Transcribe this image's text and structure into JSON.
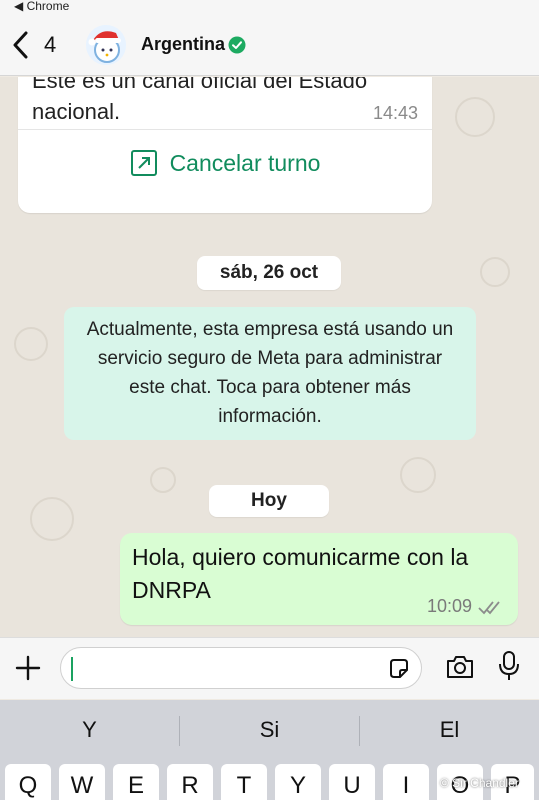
{
  "status_bar": {
    "back_app": "◀ Chrome"
  },
  "header": {
    "back_count": "4",
    "title": "Argentina",
    "verified": true
  },
  "messages": {
    "top_incoming": {
      "text": "Este es un canal oficial del Estado nacional.",
      "time": "14:43",
      "action_label": "Cancelar turno"
    },
    "date_chip_1": "sáb, 26 oct",
    "system_notice": "Actualmente, esta empresa está usando un servicio seguro de Meta para administrar este chat. Toca para obtener más información.",
    "date_chip_2": "Hoy",
    "outgoing": {
      "text": "Hola, quiero comunicarme con la DNRPA",
      "time": "10:09",
      "status": "read"
    }
  },
  "compose": {
    "value": "",
    "placeholder": ""
  },
  "keyboard": {
    "suggestions": [
      "Y",
      "Si",
      "El"
    ],
    "row1": [
      "Q",
      "W",
      "E",
      "R",
      "T",
      "Y",
      "U",
      "I",
      "O",
      "P"
    ]
  },
  "watermark": "© Sir Chandler",
  "colors": {
    "accent_green": "#118c5d",
    "outgoing_bubble": "#d9fdd3",
    "system_bubble": "#d8f5ea",
    "chat_background": "#e9e4dc"
  },
  "icons": [
    "chevron-left-icon",
    "verified-badge-icon",
    "external-link-icon",
    "double-check-icon",
    "plus-icon",
    "sticker-icon",
    "camera-icon",
    "microphone-icon"
  ]
}
